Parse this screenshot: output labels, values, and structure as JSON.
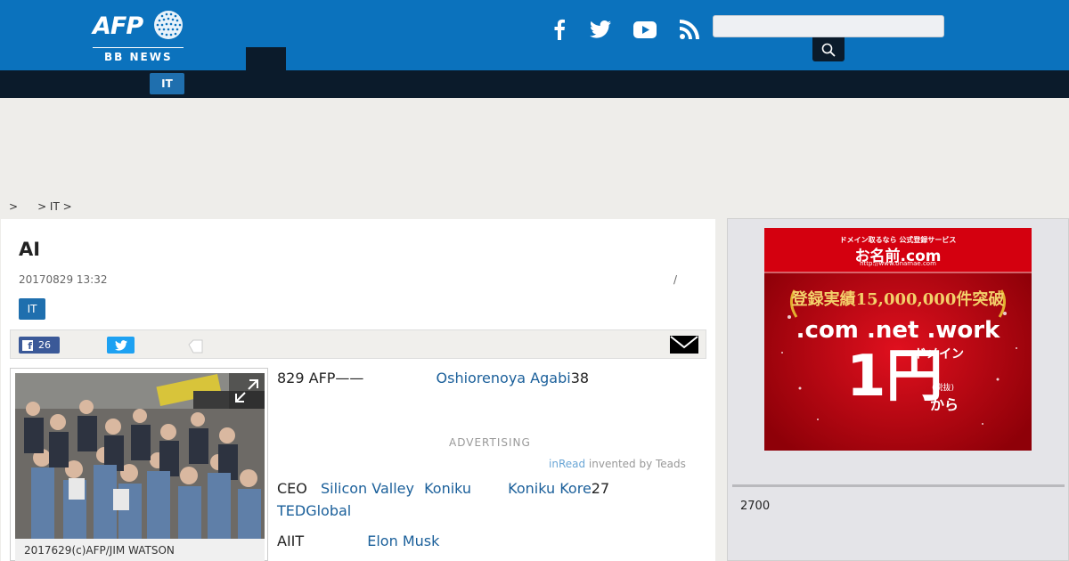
{
  "header": {
    "logo_text": "AFP",
    "logo_sub": "BB NEWS",
    "social_icons": [
      "facebook-icon",
      "twitter-icon",
      "youtube-icon",
      "rss-icon"
    ],
    "search_placeholder": ""
  },
  "nav": {
    "active_category": "IT"
  },
  "breadcrumb": [
    "&gt;",
    "&gt; IT &gt;"
  ],
  "article": {
    "title": "AI",
    "date": "20170829 13:32",
    "meta_slash": "/",
    "tag": "IT",
    "share": {
      "facebook_count": "26"
    },
    "photo_caption": "2017629(c)AFP/JIM WATSON",
    "para1": {
      "prefix": "829 AFP——",
      "link": "Oshiorenoya Agabi",
      "suffix": "38"
    },
    "advertising_label": "ADVERTISING",
    "inread": {
      "brand": "inRead",
      "text": " invented by Teads"
    },
    "para2": {
      "prefix": "CEO",
      "link1": "Silicon Valley",
      "link2": "Koniku",
      "link3": "Koniku Kore",
      "suffix": "27",
      "link4": "TEDGlobal"
    },
    "para3": {
      "prefix": "AIIT",
      "link": "Elon Musk"
    }
  },
  "sidebar": {
    "ad": {
      "top_line": "ドメイン取るなら 公式登録サービス",
      "brand": "お名前.com",
      "url": "http://www.onamae.com",
      "banner": "登録実績15,000,000件突破",
      "tlds": ".com .net .work",
      "label": "ドメイン",
      "price": "1円",
      "tax": "(税抜)",
      "from": "から"
    },
    "count": "2700"
  },
  "colors": {
    "brand_blue": "#0b72bd",
    "navy": "#0b1b2b",
    "link": "#1a5f9a",
    "facebook": "#3b5998",
    "twitter": "#1da1f2",
    "ad_red": "#b5000d"
  }
}
